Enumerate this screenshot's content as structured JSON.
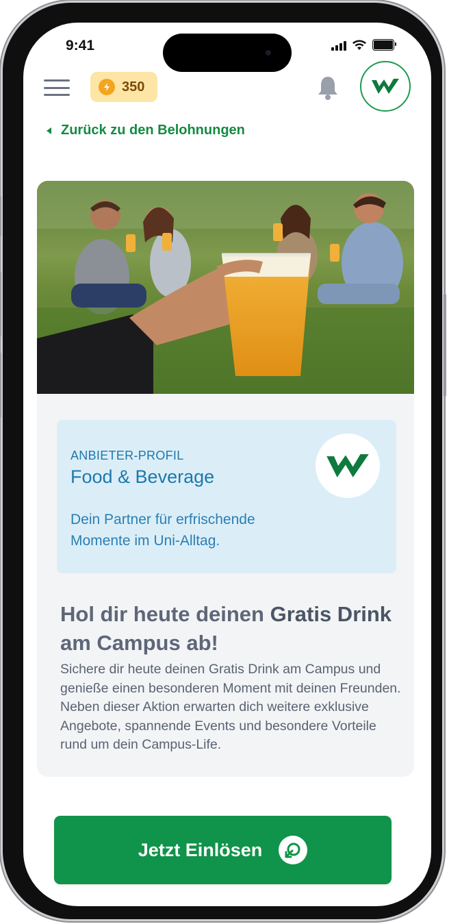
{
  "status_bar": {
    "time": "9:41"
  },
  "header": {
    "points": "350",
    "menu_icon": "hamburger-menu-icon",
    "notification_icon": "bell-icon",
    "brand_icon": "w-logo-icon"
  },
  "navigation": {
    "back_label": "Zurück zu den Belohnungen"
  },
  "offer": {
    "image_alt": "Freunde auf einer Wiese mit Bechern, Hand hält einen Becher Bier",
    "provider_kicker": "ANBIETER-PROFIL",
    "provider_name": "Food & Beverage",
    "provider_description": "Dein Partner für erfrischende Momente im Uni-Alltag.",
    "headline_part1": "Hol dir heute deinen ",
    "headline_bold1": "Gratis Drink",
    "headline_part2": " am Campus ab!",
    "body": "Sichere dir heute deinen Gratis Drink am Campus und genieße einen besonderen Moment mit deinen Freunden. Neben dieser Aktion erwarten dich weitere exklusive Angebote, spannende Events und besondere Vorteile rund um dein Campus-Life."
  },
  "cta": {
    "label": "Jetzt Einlösen",
    "icon": "redeem-arrow-icon"
  },
  "colors": {
    "brand_green": "#10934a",
    "profile_bg": "#dbeef7",
    "profile_text": "#1f77ab",
    "points_bg": "#fde5a6"
  }
}
